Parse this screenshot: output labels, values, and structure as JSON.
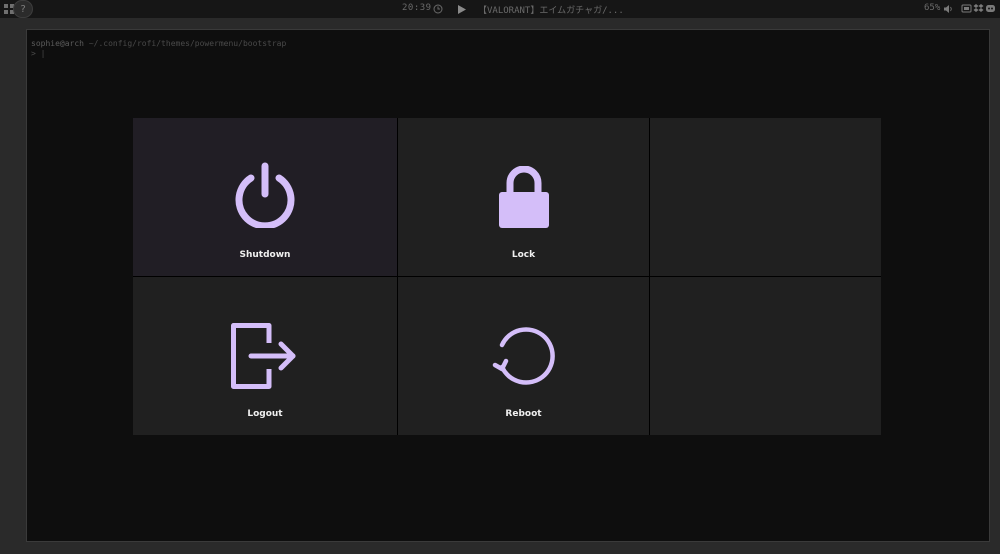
{
  "topbar": {
    "workspace_active": "?",
    "clock": "20:39",
    "media_title": "【VALORANT】エイムガチャガ/...",
    "volume": "65%",
    "icons": {
      "workspace": "app-grid-icon",
      "clock": "clock-icon",
      "media": "play-icon",
      "volume": "speaker-icon",
      "tray": [
        "tray-app-icon",
        "dropbox-icon",
        "discord-icon"
      ]
    }
  },
  "terminal": {
    "prompt_user": "sophie@arch",
    "prompt_path": "~/.config/rofi/themes/powermenu/bootstrap",
    "cursor_line": "> |"
  },
  "power_menu": {
    "accent_color": "#d4bef9",
    "active_tile_bg": "#211e25",
    "tile_bg": "#202020",
    "options": [
      {
        "label": "Shutdown",
        "icon": "power-icon",
        "selected": true
      },
      {
        "label": "Lock",
        "icon": "lock-icon",
        "selected": false
      },
      {
        "label": "Logout",
        "icon": "logout-icon",
        "selected": false
      },
      {
        "label": "Reboot",
        "icon": "reboot-icon",
        "selected": false
      }
    ]
  }
}
